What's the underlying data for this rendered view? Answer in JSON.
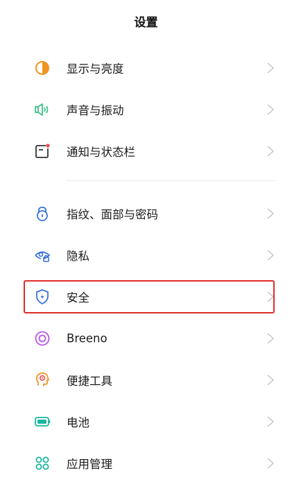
{
  "header": {
    "title": "设置"
  },
  "section1": [
    {
      "label": "显示与亮度",
      "icon": "display-brightness-icon"
    },
    {
      "label": "声音与振动",
      "icon": "sound-vibration-icon"
    },
    {
      "label": "通知与状态栏",
      "icon": "notification-statusbar-icon"
    }
  ],
  "section2": [
    {
      "label": "指纹、面部与密码",
      "icon": "lock-icon"
    },
    {
      "label": "隐私",
      "icon": "privacy-eye-icon"
    },
    {
      "label": "安全",
      "icon": "security-shield-icon"
    },
    {
      "label": "Breeno",
      "icon": "breeno-icon"
    },
    {
      "label": "便捷工具",
      "icon": "convenience-tools-icon"
    },
    {
      "label": "电池",
      "icon": "battery-icon"
    },
    {
      "label": "应用管理",
      "icon": "app-management-icon"
    }
  ],
  "colors": {
    "orange": "#f29422",
    "green": "#3cc28b",
    "red": "#ee4545",
    "blue": "#3b73d9",
    "purple": "#b955e8",
    "teal": "#19b79e",
    "highlight": "#e02b27",
    "chevron": "#c9c9c9"
  }
}
